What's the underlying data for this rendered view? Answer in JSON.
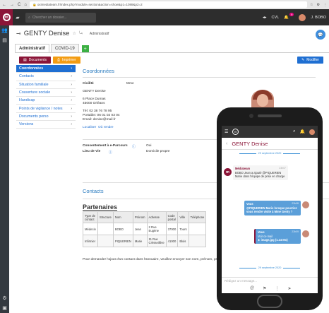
{
  "browser": {
    "nav": [
      "←",
      "→",
      "C",
      "⌂"
    ],
    "url": "oximediateam.fr/index.php?module=section&action=show&p1=1088&p2=2"
  },
  "app": {
    "search_placeholder": "Chercher un dossier...",
    "user_name": "J. BOBO",
    "cvl_label": "CVL",
    "notif_count": "9"
  },
  "page": {
    "title": "GENTY Denise",
    "breadcrumb": "Administratif",
    "tabs": [
      "Administratif",
      "COVID-19"
    ],
    "btn_documents": "Documents",
    "btn_imprimer": "Imprimer",
    "btn_modifier": "Modifier",
    "menu": [
      "Coordonnées",
      "Contacts",
      "Situation familiale",
      "Couverture sociale",
      "Handicap",
      "Points de vigilance / notes",
      "Documents perso",
      "Versions"
    ],
    "coord": {
      "section_title": "Coordonnées",
      "civ_label": "Civilité",
      "civ_value": "Mme",
      "name": "GENTY Denise",
      "address1": "6 Place Dumas",
      "address2": "45000 Orléans",
      "tel": "Tél: 02 38 76 78 95",
      "portable": "Portable: 06 01 02 03 04",
      "email": "Email: denise@mail.fr",
      "loc_link": "Localiser",
      "rdv_link": "Où rendre",
      "consent_label": "Consentement à e-Parcours",
      "consent_value": "Oui",
      "lieu_label": "Lieu de Vie",
      "lieu_value": "Domicile propre"
    },
    "contacts_title": "Contacts",
    "partners_title": "Partenaires",
    "table": {
      "headers": [
        "Type de contact",
        "Structure",
        "Nom",
        "Prénom",
        "Adresse",
        "Code postal",
        "Ville",
        "Téléphone"
      ],
      "rows": [
        [
          "Médecin",
          "",
          "BOBO",
          "Jean",
          "2 Rue Eugène",
          "37000",
          "Tours",
          ""
        ],
        [
          "Infirmier",
          "",
          "PIQUERIEN",
          "Marie",
          "11 Rue Crèsseillère",
          "41000",
          "Blois",
          ""
        ]
      ]
    },
    "footnote": "Pour demander l'ajout d'un contact dans l'annuaire, veuillez envoyer son nom, prénom, profession, coo"
  },
  "mobile": {
    "title": "GENTY Denise",
    "date1": "29 septembre 2020",
    "msg1_author": "Médiateam",
    "msg1_time": "23h07",
    "msg1_text": "BOBO Jean a ajouté @PIQUERIEN Marie dans l'équipe de prise en charge",
    "msg2_author": "Vous",
    "msg2_time": "23h08",
    "msg2_text": "@PIQUERIEN Marie lorsque pourriez vous rendre visite à Mme Genty ?",
    "msg3_author": "Vous",
    "msg3_time": "23h09",
    "msg3_text": "Voir ce mail",
    "msg3_attach": "image.jpg (1.14 Mo)",
    "date2": "29 septembre 2020",
    "input_placeholder": "Rédigez un message..."
  },
  "colors": {
    "brand": "#8b1538",
    "link": "#1f6fd2",
    "accent_orange": "#f39c12",
    "add_green": "#3cb043"
  }
}
